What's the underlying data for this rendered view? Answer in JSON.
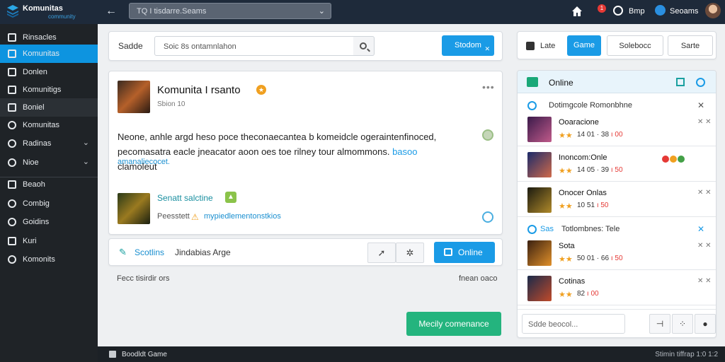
{
  "app": {
    "logo_text": "Komunitas",
    "logo_sub": "community"
  },
  "topbar": {
    "back_glyph": "←",
    "search_text": "TQ I tisdarre.Seams",
    "search_chevron": "⌄",
    "notif_count": "1",
    "app_label": "Bmp",
    "user_name": "Seoams",
    "icons": [
      "back-icon",
      "home-icon",
      "notification-badge",
      "globe-icon",
      "user-icon",
      "avatar"
    ]
  },
  "sidebar": {
    "items": [
      {
        "label": "Rinsacles",
        "icon": "square",
        "state": "normal"
      },
      {
        "label": "Komunitas",
        "icon": "square",
        "state": "active"
      },
      {
        "label": "Donlen",
        "icon": "square",
        "state": "normal"
      },
      {
        "label": "Komunitigs",
        "icon": "square",
        "state": "normal"
      },
      {
        "label": "Boniel",
        "icon": "square",
        "state": "dark"
      },
      {
        "label": "Komunitas",
        "icon": "round",
        "state": "normal"
      },
      {
        "label": "Radinas",
        "icon": "round",
        "state": "normal",
        "chevron": "⌄"
      },
      {
        "label": "Nioe",
        "icon": "round",
        "state": "normal",
        "chevron": "⌄"
      },
      {
        "label": "Beaoh",
        "icon": "square",
        "state": "normal"
      },
      {
        "label": "Combig",
        "icon": "round",
        "state": "normal"
      },
      {
        "label": "Goidins",
        "icon": "round",
        "state": "normal"
      },
      {
        "label": "Kuri",
        "icon": "square",
        "state": "normal"
      },
      {
        "label": "Komonits",
        "icon": "round",
        "state": "normal"
      }
    ]
  },
  "filter": {
    "label": "Sadde",
    "input_text": "Soic 8s ontamnlahon",
    "button": "Stodom",
    "button_badge": "✕"
  },
  "post": {
    "title": "Komunita I rsanto",
    "subtitle": "Sbion 10",
    "more": "•••",
    "body_line1": "Neone, anhle argd heso poce theconaecantea b komeidcle ogeraintenfinoced,",
    "body_line2": "pecomasatra eacle jneacator aoon oes toe rilney tour almommons.",
    "body_link": "basoo",
    "body_line2_tail": " clamoleut",
    "tag": "amanaliecocet.",
    "game_title": "Senatt salctine",
    "game_up": "▲",
    "game_meta": "Peesstett",
    "game_link": "mypiedlementonstkios",
    "warn_glyph": "⚠"
  },
  "action_bar": {
    "label": "Scotlins",
    "text": "Jindabias Arge",
    "btn1": "➚",
    "btn2": "✲",
    "online_button": "Online"
  },
  "footer": {
    "left": "Fecc tisirdir ors",
    "right": "fnean oaco",
    "green_button": "Mecily comenance"
  },
  "right_panel": {
    "tab_label": "Late",
    "tab_active": "Game",
    "tab2": "Solebocc",
    "tab3": "Sarte",
    "chat_title": "Online",
    "section1_title": "Dotimgcole Romonbhne",
    "section2_badge": "Sas",
    "section2_title": "Totlombnes: Tele",
    "games": [
      {
        "name": "Ooaracione",
        "stars": "★★",
        "meta": "14 01",
        "meta2": "38",
        "meta_red": "ı 00",
        "thumb": [
          "#3a1a4a",
          "#c05a8a"
        ]
      },
      {
        "name": "Inoncom:Onle",
        "stars": "★★",
        "meta": "14 05",
        "meta2": "39",
        "meta_red": "ı 50",
        "thumb": [
          "#1a2a6a",
          "#d06a4a"
        ],
        "badges": true
      },
      {
        "name": "Onocer Onlas",
        "stars": "★★",
        "meta": "10 51",
        "meta2": "",
        "meta_red": "ı 50",
        "thumb": [
          "#1a1a10",
          "#b08a2a"
        ]
      },
      {
        "name": "Sota",
        "stars": "★★",
        "meta": "50 01",
        "meta2": "66",
        "meta_red": "ı 50",
        "thumb": [
          "#3a2010",
          "#e0902a"
        ]
      },
      {
        "name": "Cotinas",
        "stars": "★★",
        "meta": "82",
        "meta2": "",
        "meta_red": "ı 00",
        "thumb": [
          "#1a2a4a",
          "#c04a2a"
        ]
      }
    ],
    "chat_input": "Sdde beocol...",
    "chat_btn1": "⊣",
    "chat_btn2": "⁘",
    "chat_btn3": "●"
  },
  "statusbar": {
    "left": "Boodldt Game",
    "right": "Stimin tiffrap 1:0 1:2"
  },
  "colors": {
    "accent": "#1a9be6",
    "topbar": "#1e2a3a",
    "sidebar": "#1f2327",
    "green": "#24b47e"
  }
}
